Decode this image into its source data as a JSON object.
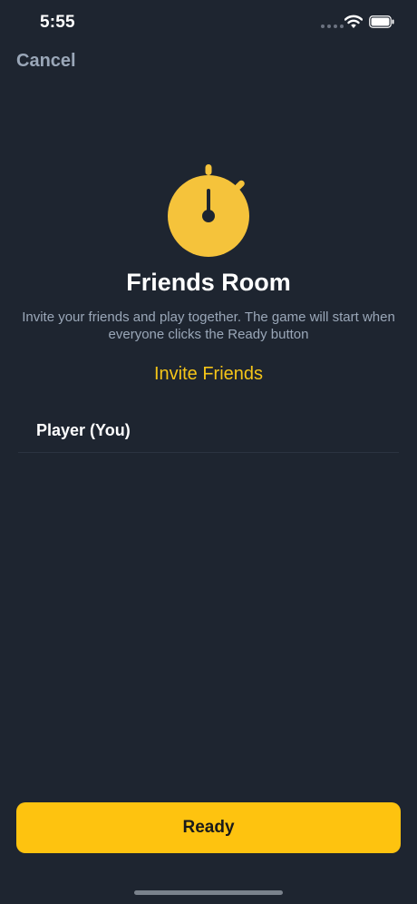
{
  "status_bar": {
    "time": "5:55",
    "icons": [
      "signal-dots-icon",
      "wifi-icon",
      "battery-icon"
    ]
  },
  "nav": {
    "cancel_label": "Cancel"
  },
  "room": {
    "icon": "timer-icon",
    "title": "Friends Room",
    "description": "Invite your friends and play together. The game will start when everyone clicks the Ready button",
    "invite_label": "Invite Friends"
  },
  "players": [
    {
      "name": "Player (You)"
    }
  ],
  "actions": {
    "ready_label": "Ready"
  },
  "colors": {
    "background": "#1e2530",
    "accent": "#fec30f",
    "muted_text": "#9aa7b8",
    "divider": "#2b3340"
  }
}
